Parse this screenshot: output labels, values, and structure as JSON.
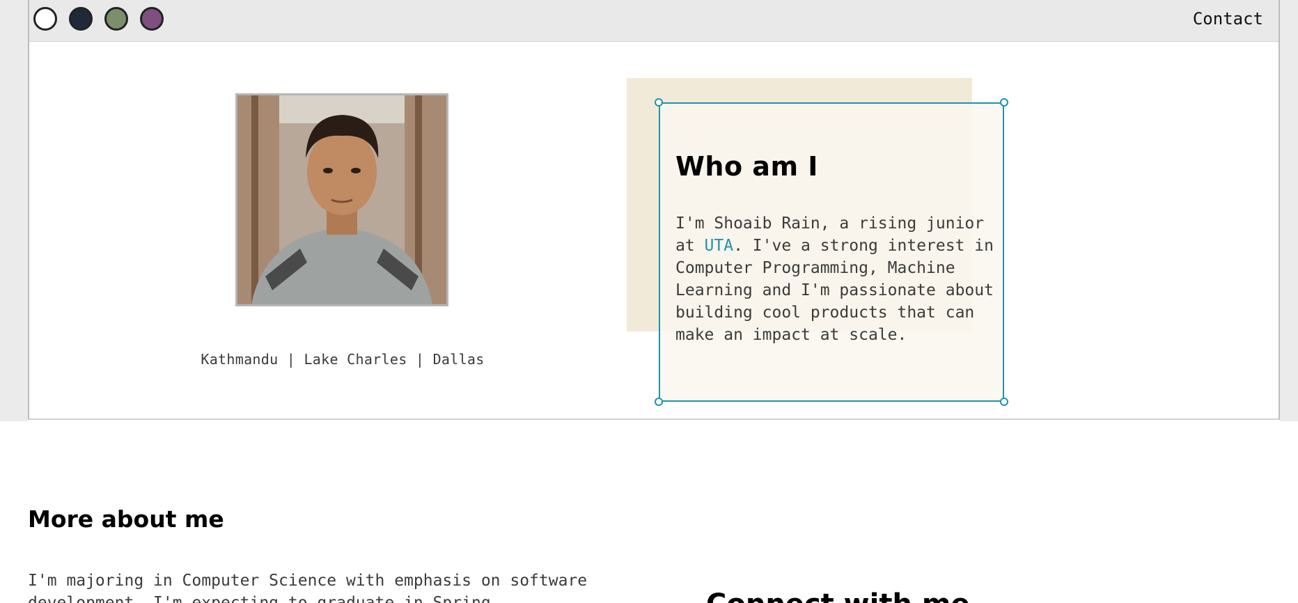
{
  "nav": {
    "contact_label": "Contact",
    "theme_swatches": [
      {
        "name": "white",
        "color": "#ffffff"
      },
      {
        "name": "navy",
        "color": "#1e2a3a"
      },
      {
        "name": "sage",
        "color": "#7b8f6a"
      },
      {
        "name": "plum",
        "color": "#7f4f7f"
      }
    ]
  },
  "profile": {
    "locations": "Kathmandu | Lake Charles | Dallas"
  },
  "about": {
    "title": "Who am I",
    "text_before": "I'm Shoaib Rain, a rising junior at ",
    "link_text": "UTA",
    "text_after": ". I've a strong interest in Computer Programming, Machine Learning and I'm passionate about building cool products that can make an impact at scale."
  },
  "more": {
    "title": "More about me",
    "text": "I'm majoring in Computer Science with emphasis on software development. I'm expecting to graduate in Spring"
  },
  "connect": {
    "title": "Connect with me"
  },
  "colors": {
    "accent": "#1f93a8",
    "card_bg": "#f2ead9"
  }
}
